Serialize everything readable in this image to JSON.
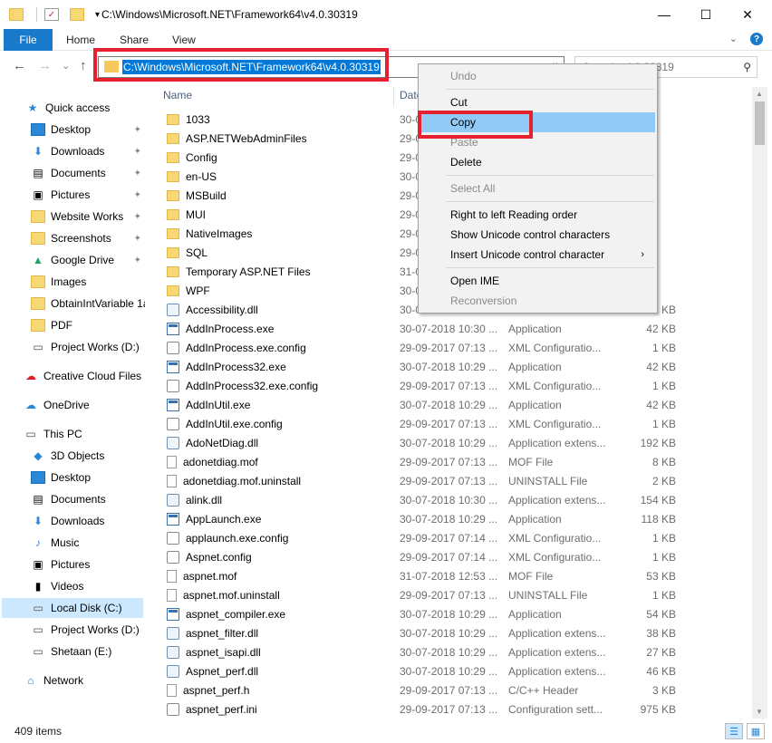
{
  "window": {
    "title": "C:\\Windows\\Microsoft.NET\\Framework64\\v4.0.30319",
    "min_glyph": "—",
    "max_glyph": "☐",
    "close_glyph": "✕",
    "qat_arrow": "▾"
  },
  "ribbon": {
    "tabs": [
      "File",
      "Home",
      "Share",
      "View"
    ],
    "expand_glyph": "⌄",
    "help_glyph": "?"
  },
  "nav": {
    "back": "←",
    "forward": "→",
    "recent": "⌄",
    "up": "↑",
    "address": "C:\\Windows\\Microsoft.NET\\Framework64\\v4.0.30319",
    "address_dropdown": "⌄",
    "search_placeholder": "Search v4.0.30319",
    "search_glyph": "⚲"
  },
  "sidebar": {
    "pin_glyph": "📌",
    "items": [
      {
        "label": "Quick access",
        "icon": "star-icon"
      },
      {
        "label": "Desktop",
        "icon": "desktop-icon",
        "pinned": true
      },
      {
        "label": "Downloads",
        "icon": "download-icon",
        "pinned": true
      },
      {
        "label": "Documents",
        "icon": "documents-icon",
        "pinned": true
      },
      {
        "label": "Pictures",
        "icon": "pictures-icon",
        "pinned": true
      },
      {
        "label": "Website Works",
        "icon": "folder-icon",
        "pinned": true
      },
      {
        "label": "Screenshots",
        "icon": "folder-icon",
        "pinned": true
      },
      {
        "label": "Google Drive",
        "icon": "google-drive-icon",
        "pinned": true
      },
      {
        "label": "Images",
        "icon": "folder-icon"
      },
      {
        "label": "ObtainIntVariable 1a",
        "icon": "folder-icon"
      },
      {
        "label": "PDF",
        "icon": "folder-icon"
      },
      {
        "label": "Project Works (D:)",
        "icon": "drive-icon"
      },
      {
        "label": "Creative Cloud Files",
        "icon": "creative-cloud-icon"
      },
      {
        "label": "OneDrive",
        "icon": "onedrive-icon"
      },
      {
        "label": "This PC",
        "icon": "pc-icon"
      },
      {
        "label": "3D Objects",
        "icon": "3d-objects-icon"
      },
      {
        "label": "Desktop",
        "icon": "desktop-icon"
      },
      {
        "label": "Documents",
        "icon": "documents-icon"
      },
      {
        "label": "Downloads",
        "icon": "download-icon"
      },
      {
        "label": "Music",
        "icon": "music-icon"
      },
      {
        "label": "Pictures",
        "icon": "pictures-icon"
      },
      {
        "label": "Videos",
        "icon": "videos-icon"
      },
      {
        "label": "Local Disk (C:)",
        "icon": "drive-icon",
        "selected": true
      },
      {
        "label": "Project Works (D:)",
        "icon": "drive-icon"
      },
      {
        "label": "Shetaan (E:)",
        "icon": "drive-icon"
      },
      {
        "label": "Network",
        "icon": "network-icon"
      }
    ]
  },
  "columns": {
    "name": "Name",
    "date": "Date"
  },
  "files": [
    {
      "name": "1033",
      "date": "30-0",
      "type": "",
      "size": "",
      "kind": "folder"
    },
    {
      "name": "ASP.NETWebAdminFiles",
      "date": "29-0",
      "type": "",
      "size": "",
      "kind": "folder"
    },
    {
      "name": "Config",
      "date": "29-0",
      "type": "",
      "size": "",
      "kind": "folder"
    },
    {
      "name": "en-US",
      "date": "30-0",
      "type": "",
      "size": "",
      "kind": "folder"
    },
    {
      "name": "MSBuild",
      "date": "29-0",
      "type": "",
      "size": "",
      "kind": "folder"
    },
    {
      "name": "MUI",
      "date": "29-0",
      "type": "",
      "size": "",
      "kind": "folder"
    },
    {
      "name": "NativeImages",
      "date": "29-0",
      "type": "",
      "size": "",
      "kind": "folder"
    },
    {
      "name": "SQL",
      "date": "29-0",
      "type": "",
      "size": "",
      "kind": "folder"
    },
    {
      "name": "Temporary ASP.NET Files",
      "date": "31-0",
      "type": "",
      "size": "",
      "kind": "folder"
    },
    {
      "name": "WPF",
      "date": "30-0",
      "type": "",
      "size": "",
      "kind": "folder"
    },
    {
      "name": "Accessibility.dll",
      "date": "30-0",
      "type": "",
      "size": "6 KB",
      "kind": "dll"
    },
    {
      "name": "AddInProcess.exe",
      "date": "30-07-2018 10:30 ...",
      "type": "Application",
      "size": "42 KB",
      "kind": "exe"
    },
    {
      "name": "AddInProcess.exe.config",
      "date": "29-09-2017 07:13 ...",
      "type": "XML Configuratio...",
      "size": "1 KB",
      "kind": "cfg"
    },
    {
      "name": "AddInProcess32.exe",
      "date": "30-07-2018 10:29 ...",
      "type": "Application",
      "size": "42 KB",
      "kind": "exe"
    },
    {
      "name": "AddInProcess32.exe.config",
      "date": "29-09-2017 07:13 ...",
      "type": "XML Configuratio...",
      "size": "1 KB",
      "kind": "cfg"
    },
    {
      "name": "AddInUtil.exe",
      "date": "30-07-2018 10:29 ...",
      "type": "Application",
      "size": "42 KB",
      "kind": "exe"
    },
    {
      "name": "AddInUtil.exe.config",
      "date": "29-09-2017 07:13 ...",
      "type": "XML Configuratio...",
      "size": "1 KB",
      "kind": "cfg"
    },
    {
      "name": "AdoNetDiag.dll",
      "date": "30-07-2018 10:29 ...",
      "type": "Application extens...",
      "size": "192 KB",
      "kind": "dll"
    },
    {
      "name": "adonetdiag.mof",
      "date": "29-09-2017 07:13 ...",
      "type": "MOF File",
      "size": "8 KB",
      "kind": "doc"
    },
    {
      "name": "adonetdiag.mof.uninstall",
      "date": "29-09-2017 07:13 ...",
      "type": "UNINSTALL File",
      "size": "2 KB",
      "kind": "doc"
    },
    {
      "name": "alink.dll",
      "date": "30-07-2018 10:30 ...",
      "type": "Application extens...",
      "size": "154 KB",
      "kind": "dll"
    },
    {
      "name": "AppLaunch.exe",
      "date": "30-07-2018 10:29 ...",
      "type": "Application",
      "size": "118 KB",
      "kind": "exe"
    },
    {
      "name": "applaunch.exe.config",
      "date": "29-09-2017 07:14 ...",
      "type": "XML Configuratio...",
      "size": "1 KB",
      "kind": "cfg"
    },
    {
      "name": "Aspnet.config",
      "date": "29-09-2017 07:14 ...",
      "type": "XML Configuratio...",
      "size": "1 KB",
      "kind": "cfg"
    },
    {
      "name": "aspnet.mof",
      "date": "31-07-2018 12:53 ...",
      "type": "MOF File",
      "size": "53 KB",
      "kind": "doc"
    },
    {
      "name": "aspnet.mof.uninstall",
      "date": "29-09-2017 07:13 ...",
      "type": "UNINSTALL File",
      "size": "1 KB",
      "kind": "doc"
    },
    {
      "name": "aspnet_compiler.exe",
      "date": "30-07-2018 10:29 ...",
      "type": "Application",
      "size": "54 KB",
      "kind": "exe"
    },
    {
      "name": "aspnet_filter.dll",
      "date": "30-07-2018 10:29 ...",
      "type": "Application extens...",
      "size": "38 KB",
      "kind": "dll"
    },
    {
      "name": "aspnet_isapi.dll",
      "date": "30-07-2018 10:29 ...",
      "type": "Application extens...",
      "size": "27 KB",
      "kind": "dll"
    },
    {
      "name": "Aspnet_perf.dll",
      "date": "30-07-2018 10:29 ...",
      "type": "Application extens...",
      "size": "46 KB",
      "kind": "dll"
    },
    {
      "name": "aspnet_perf.h",
      "date": "29-09-2017 07:13 ...",
      "type": "C/C++ Header",
      "size": "3 KB",
      "kind": "doc"
    },
    {
      "name": "aspnet_perf.ini",
      "date": "29-09-2017 07:13 ...",
      "type": "Configuration sett...",
      "size": "975 KB",
      "kind": "cfg"
    }
  ],
  "context_menu": [
    {
      "label": "Undo",
      "disabled": true
    },
    {
      "sep": true
    },
    {
      "label": "Cut"
    },
    {
      "label": "Copy",
      "hover": true
    },
    {
      "label": "Paste",
      "disabled": true
    },
    {
      "label": "Delete"
    },
    {
      "sep": true
    },
    {
      "label": "Select All",
      "disabled": true
    },
    {
      "sep": true
    },
    {
      "label": "Right to left Reading order"
    },
    {
      "label": "Show Unicode control characters"
    },
    {
      "label": "Insert Unicode control character",
      "submenu": true
    },
    {
      "sep": true
    },
    {
      "label": "Open IME"
    },
    {
      "label": "Reconversion",
      "disabled": true
    }
  ],
  "context_submenu_glyph": "›",
  "status": {
    "items": "409 items"
  },
  "colors": {
    "accent": "#1979ca",
    "selection": "#0078d7",
    "highlight_box": "#e5202f",
    "menu_hover": "#91c9f7"
  }
}
